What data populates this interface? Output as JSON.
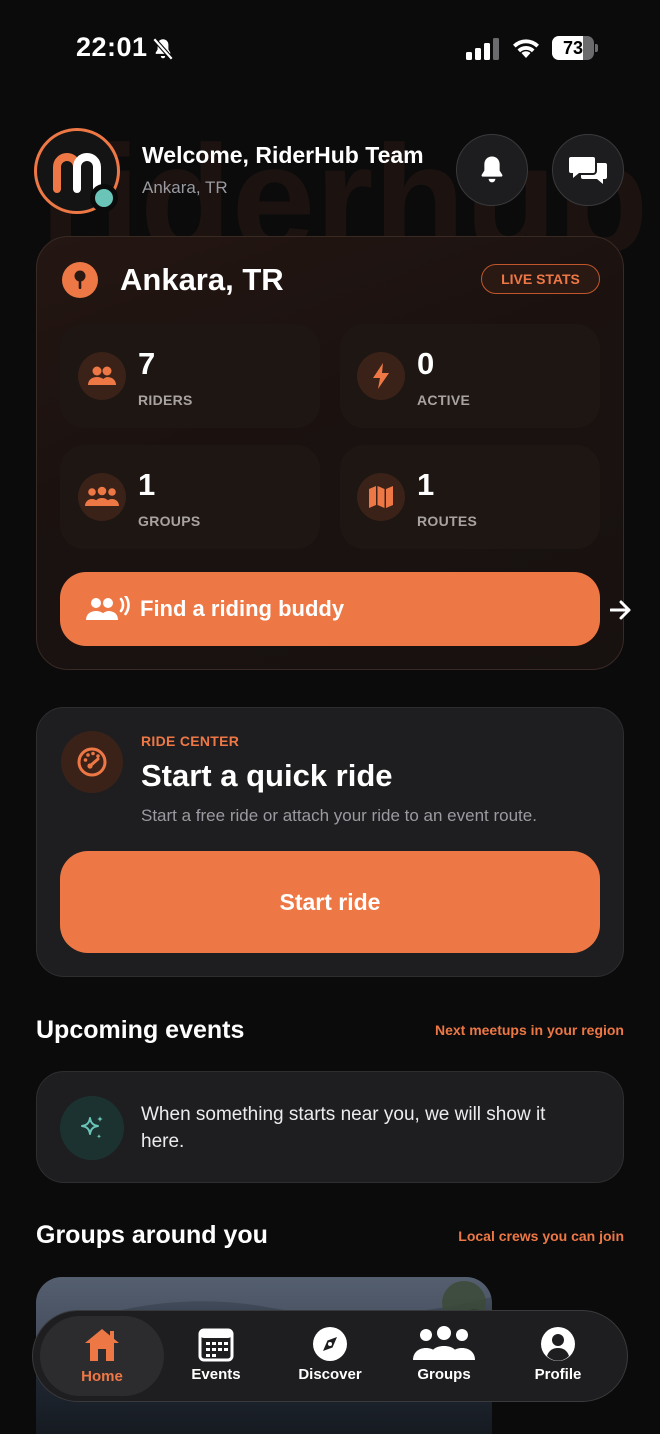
{
  "status_bar": {
    "time": "22:01",
    "battery_percent": "73",
    "icons": [
      "bell-slash-icon",
      "signal-icon",
      "wifi-icon",
      "battery-icon"
    ]
  },
  "header": {
    "welcome": "Welcome, RiderHub Team",
    "location": "Ankara, TR",
    "watermark": "riderhub"
  },
  "stats": {
    "city": "Ankara, TR",
    "badge": "LIVE STATS",
    "tiles": [
      {
        "value": "7",
        "label": "RIDERS",
        "icon": "riders-icon"
      },
      {
        "value": "0",
        "label": "ACTIVE",
        "icon": "bolt-icon"
      },
      {
        "value": "1",
        "label": "GROUPS",
        "icon": "groups-icon"
      },
      {
        "value": "1",
        "label": "ROUTES",
        "icon": "map-icon"
      }
    ],
    "find_buddy": "Find a riding buddy"
  },
  "ride_center": {
    "eyebrow": "RIDE CENTER",
    "title": "Start a quick ride",
    "description": "Start a free ride or attach your ride to an event route.",
    "button": "Start ride"
  },
  "upcoming_events": {
    "title": "Upcoming events",
    "link": "Next meetups in your region",
    "empty_text": "When something starts near you, we will show it here."
  },
  "groups": {
    "title": "Groups around you",
    "link": "Local crews you can join"
  },
  "tabs": [
    {
      "label": "Home",
      "icon": "home-icon",
      "active": true
    },
    {
      "label": "Events",
      "icon": "calendar-icon",
      "active": false
    },
    {
      "label": "Discover",
      "icon": "compass-icon",
      "active": false
    },
    {
      "label": "Groups",
      "icon": "groups-icon",
      "active": false
    },
    {
      "label": "Profile",
      "icon": "profile-icon",
      "active": false
    }
  ],
  "colors": {
    "accent": "#ee7845",
    "background": "#0b0b0c",
    "card": "#1e1e20",
    "online": "#6ac4b7"
  }
}
